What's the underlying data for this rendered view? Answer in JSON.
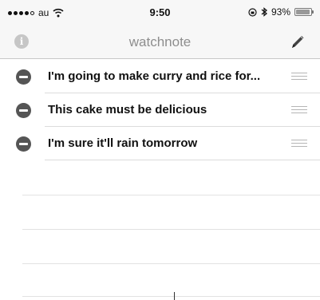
{
  "status_bar": {
    "carrier": "au",
    "time": "9:50",
    "battery_text": "93%",
    "battery_level": 0.93,
    "signal_bars_filled": 4,
    "signal_bars_total": 5
  },
  "nav": {
    "title": "watchnote",
    "info_icon": "info-icon",
    "edit_icon": "pencil-icon"
  },
  "notes": [
    {
      "text": "I'm going to make curry and rice for..."
    },
    {
      "text": "This cake must be delicious"
    },
    {
      "text": "I'm sure it'll rain tomorrow"
    }
  ],
  "colors": {
    "delete_button": "#555555",
    "title_gray": "#8e8e8e"
  }
}
